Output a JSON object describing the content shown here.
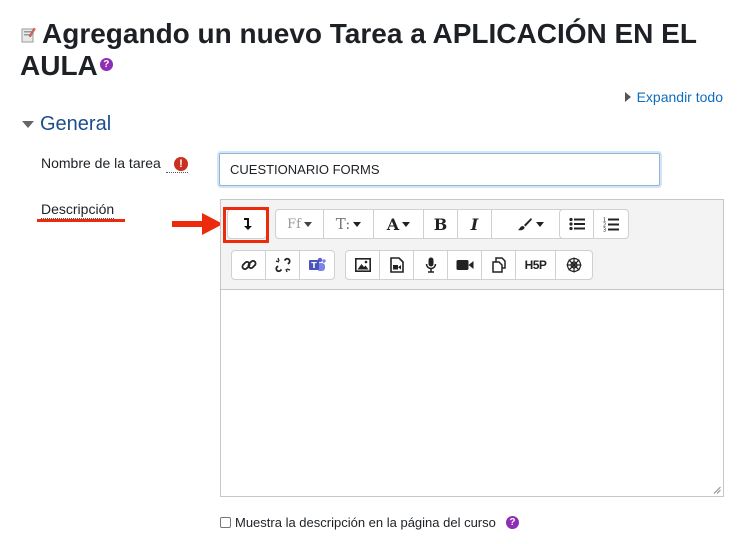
{
  "page": {
    "title_line1": "Agregando un nuevo Tarea a APLICACIÓN EN EL",
    "title_line2": "AULA",
    "help_glyph": "?"
  },
  "actions": {
    "expand_all": "Expandir todo"
  },
  "section": {
    "title": "General"
  },
  "form": {
    "name_label": "Nombre de la tarea",
    "required_glyph": "!",
    "name_value": "CUESTIONARIO FORMS",
    "description_label": "Descripción",
    "show_description_label": "Muestra la descripción en la página del curso"
  },
  "toolbar": {
    "row1": [
      {
        "name": "show-more-buttons",
        "icon": "arrow-down-turn-icon"
      },
      {
        "name": "font-family",
        "text": "Ff",
        "dropdown": true,
        "disabled": true
      },
      {
        "name": "font-size",
        "text": "T:",
        "dropdown": true
      },
      {
        "name": "text-color",
        "text": "A",
        "dropdown": true
      },
      {
        "name": "bold",
        "text": "B"
      },
      {
        "name": "italic",
        "text": "I"
      },
      {
        "name": "styles",
        "icon": "paintbrush-icon",
        "dropdown": true
      },
      {
        "name": "unordered-list",
        "icon": "bullet-list-icon"
      },
      {
        "name": "ordered-list",
        "icon": "numbered-list-icon"
      }
    ],
    "row2": [
      {
        "name": "link",
        "icon": "link-icon"
      },
      {
        "name": "unlink",
        "icon": "unlink-icon"
      },
      {
        "name": "teams",
        "icon": "teams-icon"
      },
      {
        "name": "image",
        "icon": "image-icon"
      },
      {
        "name": "media",
        "icon": "media-icon"
      },
      {
        "name": "record-audio",
        "icon": "microphone-icon"
      },
      {
        "name": "record-video",
        "icon": "video-camera-icon"
      },
      {
        "name": "manage-files",
        "icon": "files-icon"
      },
      {
        "name": "h5p",
        "text": "H5P"
      },
      {
        "name": "accessibility-checker",
        "icon": "accessibility-icon"
      }
    ]
  },
  "colors": {
    "link": "#0f6cbf",
    "section_title": "#1f4e8c",
    "required": "#ca3120",
    "help": "#8f2db4",
    "annotation": "#ee2a0c"
  }
}
